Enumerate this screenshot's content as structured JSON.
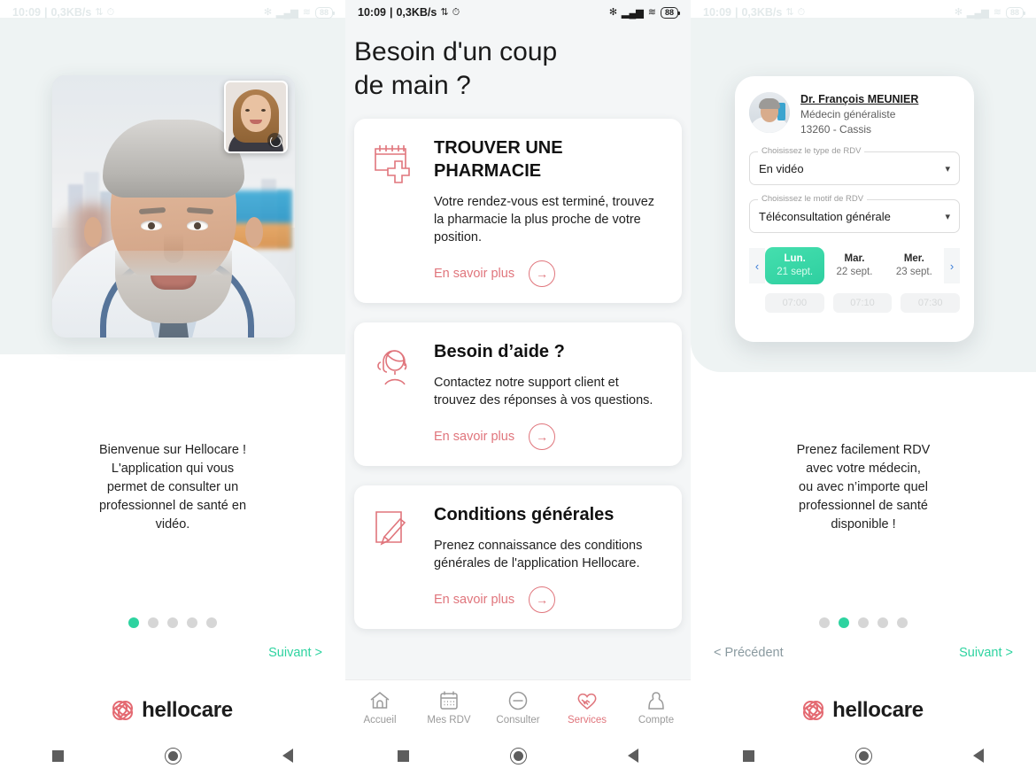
{
  "statusbar": {
    "time": "10:09",
    "separator": "|",
    "netspeed": "0,3KB/s",
    "icons": [
      "sync-off-icon",
      "alarm-icon"
    ],
    "right_icons": [
      "bluetooth-icon",
      "signal-icon",
      "wifi-icon"
    ],
    "battery": "88"
  },
  "screens": [
    {
      "id": "onboarding-video",
      "caption": "Bienvenue sur Hellocare !\nL'application qui vous\npermet de consulter un\nprofessionnel de santé en\nvidéo.",
      "caption_lines": [
        "Bienvenue sur Hellocare !",
        "L'application qui vous",
        "permet de consulter un",
        "professionnel de santé en",
        "vidéo."
      ],
      "dots": {
        "count": 5,
        "active_index": 0
      },
      "prev_label": "",
      "next_label": "Suivant >",
      "brand": "hellocare"
    },
    {
      "id": "services",
      "title_lines": [
        "Besoin d'un coup",
        "de main ?"
      ],
      "cards": [
        {
          "icon": "pharmacy-calendar-icon",
          "title": "TROUVER UNE PHARMACIE",
          "uppercase": true,
          "text": "Votre rendez-vous est terminé, trouvez la pharmacie la plus proche de votre position.",
          "cta": "En savoir plus"
        },
        {
          "icon": "support-headset-icon",
          "title": "Besoin d’aide ?",
          "uppercase": false,
          "text": "Contactez notre support client et trouvez des réponses à vos questions.",
          "cta": "En savoir plus"
        },
        {
          "icon": "document-pen-icon",
          "title": "Conditions générales",
          "uppercase": false,
          "text": "Prenez connaissance des conditions générales de l'application Hellocare.",
          "cta": "En savoir plus"
        }
      ],
      "bottom_nav": [
        {
          "icon": "home-icon",
          "label": "Accueil",
          "active": false
        },
        {
          "icon": "calendar-icon",
          "label": "Mes RDV",
          "active": false
        },
        {
          "icon": "consult-icon",
          "label": "Consulter",
          "active": false
        },
        {
          "icon": "handshake-heart-icon",
          "label": "Services",
          "active": true
        },
        {
          "icon": "account-icon",
          "label": "Compte",
          "active": false
        }
      ]
    },
    {
      "id": "onboarding-rdv",
      "doctor": {
        "name": "Dr. François MEUNIER",
        "specialty": "Médecin généraliste",
        "location": "13260 - Cassis",
        "avatar": "doctor-avatar"
      },
      "fields": [
        {
          "legend": "Choisissez le type de RDV",
          "value": "En vidéo",
          "icon": "chevron-down-icon"
        },
        {
          "legend": "Choisissez le motif de RDV",
          "value": "Téléconsultation générale",
          "icon": "chevron-down-icon"
        }
      ],
      "date_picker": {
        "prev_icon": "chevron-left-icon",
        "next_icon": "chevron-right-icon",
        "days": [
          {
            "day": "Lun.",
            "date": "21 sept.",
            "selected": true
          },
          {
            "day": "Mar.",
            "date": "22 sept.",
            "selected": false
          },
          {
            "day": "Mer.",
            "date": "23 sept.",
            "selected": false
          }
        ],
        "slots": [
          "07:00",
          "07:10",
          "07:30"
        ]
      },
      "caption_lines": [
        "Prenez facilement RDV",
        "avec votre médecin,",
        "ou avec n’importe quel",
        "professionnel de santé",
        "disponible !"
      ],
      "dots": {
        "count": 5,
        "active_index": 1
      },
      "prev_label": "< Précédent",
      "next_label": "Suivant >",
      "brand": "hellocare"
    }
  ],
  "android_nav": [
    "recents-square-icon",
    "home-circle-icon",
    "back-triangle-icon"
  ],
  "colors": {
    "accent_red": "#e0757c",
    "accent_green": "#2ed3a0",
    "panel_bg": "#f4f6f7",
    "side_shape": "#eef3f3",
    "dot_inactive": "#d6d6d6",
    "nav_inactive": "#9a9a9a"
  }
}
